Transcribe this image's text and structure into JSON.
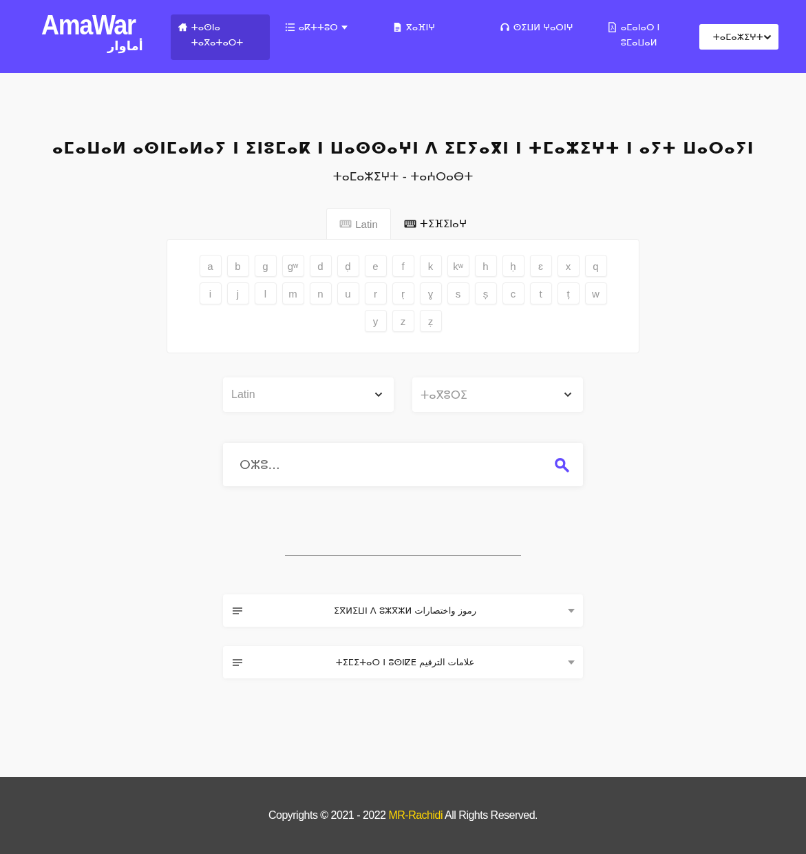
{
  "header": {
    "logo": {
      "latin": "AmaWar",
      "arabic": "أماوار"
    },
    "nav": [
      {
        "label": "ⵜⴰⵙⵏⴰ ⵜⴰⴳⴰⵜⴰⵔⵜ",
        "selected": true,
        "dropdown": false
      },
      {
        "label": "ⴰⴽⵜⵜⵓⵔ",
        "selected": false,
        "dropdown": true
      },
      {
        "label": "ⴳⴰⴼⵏⵖ",
        "selected": false,
        "dropdown": false
      },
      {
        "label": "ⵙⵉⵡⵍ ⵖⴰⵔⵏⵖ",
        "selected": false,
        "dropdown": false
      },
      {
        "label": "ⴰⵎⴰⵏⴰⵔ ⵏ ⵓⵎⴰⵡⴰⵍ",
        "selected": false,
        "dropdown": false
      }
    ],
    "language_select": {
      "value": "ⵜⴰⵎⴰⵣⵉⵖⵜ"
    }
  },
  "title": "ⴰⵎⴰⵡⴰⵍ ⴰⵙⵏⵎⴰⵍⴰⵢ ⵏ ⵉⵏⵓⵎⴰⴽ ⵏ ⵡⴰⵙⵙⴰⵖⵏ ⴷ ⵉⵎⵢⴰⴳⵏ ⵏ ⵜⵎⴰⵣⵉⵖⵜ ⵏ ⴰⵢⵜ ⵡⴰⵔⴰⵢⵏ",
  "subtitle": "ⵜⴰⵎⴰⵣⵉⵖⵜ - ⵜⴰⵄⵔⴰⴱⵜ",
  "keyboard_tabs": [
    {
      "label": "Latin",
      "selected": true
    },
    {
      "label": "ⵜⵉⴼⵉⵏⴰⵖ",
      "selected": false
    }
  ],
  "keyboard": {
    "rows": [
      [
        "a",
        "b",
        "g",
        "gʷ",
        "d",
        "ḍ",
        "e",
        "f",
        "k",
        "kʷ",
        "h",
        "ḥ",
        "ɛ",
        "x",
        "q"
      ],
      [
        "i",
        "j",
        "l",
        "m",
        "n",
        "u",
        "r",
        "ṛ",
        "ɣ",
        "s",
        "ṣ",
        "c",
        "t",
        "ṭ",
        "w"
      ],
      [
        "",
        "",
        "",
        "",
        "",
        "",
        "y",
        "z",
        "ẓ",
        "",
        "",
        "",
        "",
        "",
        ""
      ]
    ]
  },
  "selects": [
    {
      "placeholder": "Latin"
    },
    {
      "placeholder": "ⵜⴰⴳⵓⵔⵉ"
    }
  ],
  "search": {
    "placeholder": "ⵔⵣⵓ..."
  },
  "accordions": [
    {
      "title": "ⵉⴳⵍⵉⵡⵏ ⴷ ⵓⵣⴳⵣⵍ رموز واختصارات",
      "expanded": false
    },
    {
      "title": "ⵜⵉⵎⵉⵜⴰⵔ ⵏ ⵓⵙⵏⵇⴹ علامات الترقيم",
      "expanded": false
    }
  ],
  "footer": {
    "text_before": "Copyrights © 2021 - 2022",
    "link": "MR-Rachidi",
    "text_after": "All Rights Reserved."
  }
}
